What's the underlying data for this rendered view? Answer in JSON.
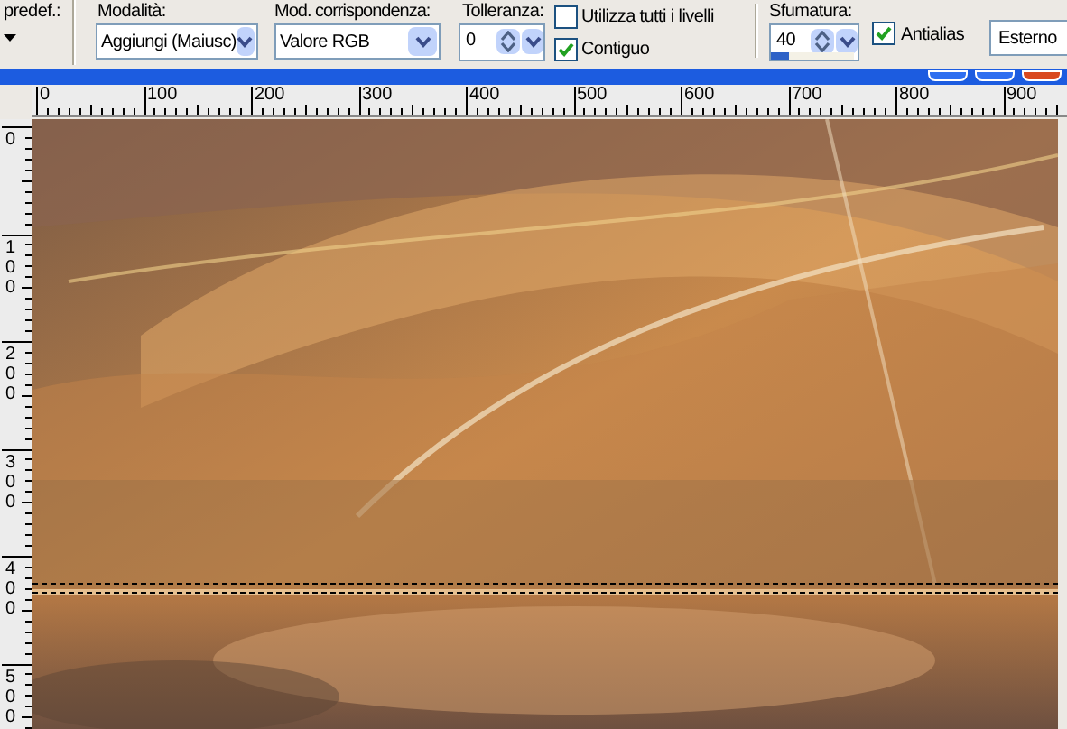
{
  "toolbar": {
    "presets": {
      "label": "predef.:"
    },
    "mode": {
      "label": "Modalità:",
      "value": "Aggiungi (Maiusc)"
    },
    "match_mode": {
      "label": "Mod. corrispondenza:",
      "value": "Valore RGB"
    },
    "tolerance": {
      "label": "Tolleranza:",
      "value": "0"
    },
    "checkboxes": [
      {
        "label": "Utilizza tutti i livelli",
        "checked": false
      },
      {
        "label": "Contiguo",
        "checked": true
      }
    ],
    "feather": {
      "label": "Sfumatura:",
      "value": "40",
      "level": 0.22
    },
    "antialias": {
      "label": "Antialias",
      "checked": true
    },
    "placement": {
      "value": "Esterno"
    }
  },
  "horizontal_ruler": {
    "labels": [
      "0",
      "100",
      "200",
      "300",
      "400",
      "500",
      "600",
      "700",
      "800",
      "900"
    ]
  },
  "vertical_ruler": {
    "labels": [
      "0",
      "100",
      "200",
      "300",
      "400",
      "500"
    ]
  }
}
